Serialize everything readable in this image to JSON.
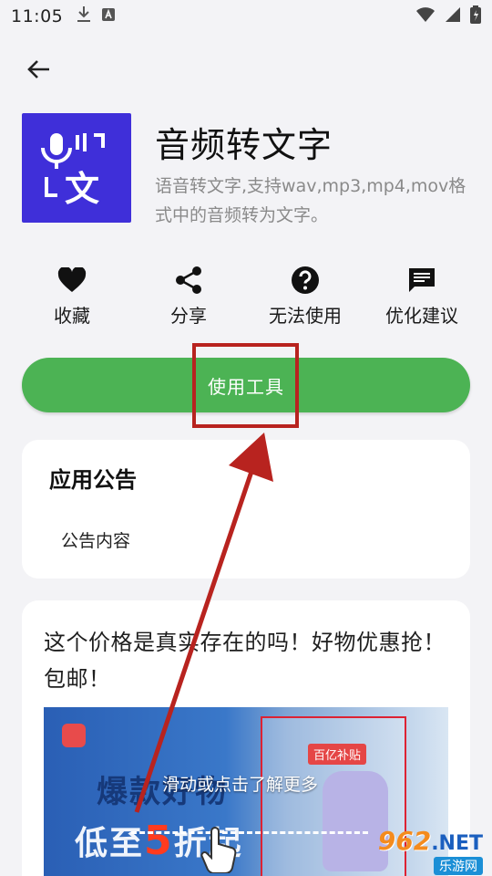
{
  "status": {
    "time": "11:05"
  },
  "app": {
    "title": "音频转文字",
    "description": "语音转文字,支持wav,mp3,mp4,mov格式中的音频转为文字。",
    "icon_glyph": "文",
    "icon_name": "speech-to-text-icon"
  },
  "actions": [
    {
      "label": "收藏",
      "icon": "heart-icon"
    },
    {
      "label": "分享",
      "icon": "share-icon"
    },
    {
      "label": "无法使用",
      "icon": "help-icon"
    },
    {
      "label": "优化建议",
      "icon": "feedback-icon"
    }
  ],
  "use_button": {
    "label": "使用工具",
    "color": "#4cb354"
  },
  "notice": {
    "title": "应用公告",
    "content": "公告内容"
  },
  "promo": {
    "text": "这个价格是真实存在的吗！好物优惠抢！包邮！",
    "banner_line1": "爆款好物",
    "banner_line2_a": "低至",
    "banner_line2_b": "5",
    "banner_line2_c": "折起",
    "banner_overlay": "滑动或点击了解更多",
    "banner_tag": "百亿补贴"
  },
  "watermark": {
    "num": "962",
    "net": ".NET",
    "sub": "乐游网"
  },
  "colors": {
    "accent": "#4cb354",
    "icon_bg": "#3f2fd9",
    "annotation": "#b8231f"
  }
}
